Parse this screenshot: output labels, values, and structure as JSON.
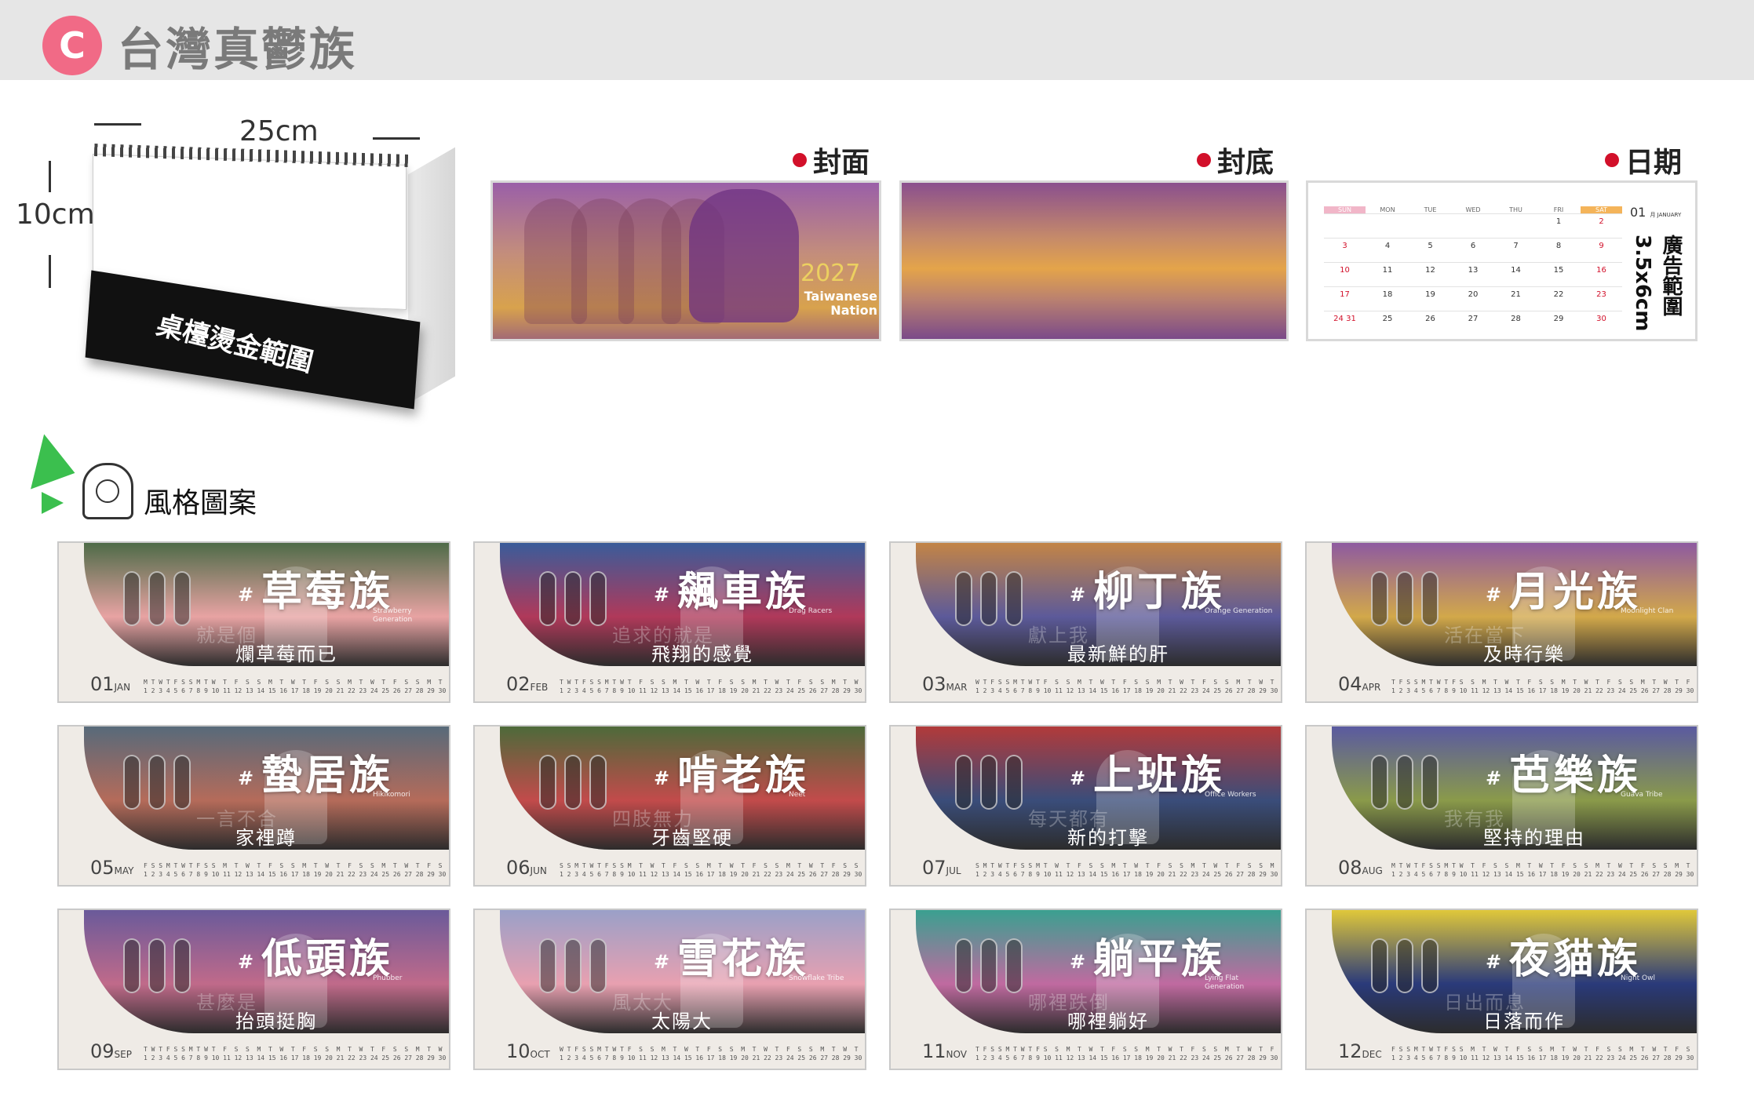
{
  "header": {
    "badge": "C",
    "title": "台灣真鬱族"
  },
  "desk": {
    "width_label": "25cm",
    "height_label": "10cm",
    "base_label": "桌檯燙金範圍"
  },
  "sections": {
    "cover": "封面",
    "back": "封底",
    "date": "日期",
    "style": "風格圖案"
  },
  "cover_art": {
    "year": "2027",
    "line1": "Taiwanese",
    "line2": "Nation"
  },
  "date_panel": {
    "weekdays": [
      "SUN",
      "MON",
      "TUE",
      "WED",
      "THU",
      "FRI",
      "SAT"
    ],
    "month_label": "01",
    "month_sub": "月 JANUARY",
    "ad_area": "廣告範圍",
    "ad_size": "3.5x6cm",
    "rows": [
      [
        "",
        "",
        "",
        "",
        "",
        "1",
        "2"
      ],
      [
        "3",
        "4",
        "5",
        "6",
        "7",
        "8",
        "9"
      ],
      [
        "10",
        "11",
        "12",
        "13",
        "14",
        "15",
        "16"
      ],
      [
        "17",
        "18",
        "19",
        "20",
        "21",
        "22",
        "23"
      ],
      [
        "24 31",
        "25",
        "26",
        "27",
        "28",
        "29",
        "30"
      ]
    ]
  },
  "months": [
    {
      "num": "01",
      "abbr": "JAN",
      "name": "草莓族",
      "en": "Strawberry Generation",
      "p1": "就是個",
      "p2": "爛草莓而已"
    },
    {
      "num": "02",
      "abbr": "FEB",
      "name": "飆車族",
      "en": "Drag Racers",
      "p1": "追求的就是",
      "p2": "飛翔的感覺"
    },
    {
      "num": "03",
      "abbr": "MAR",
      "name": "柳丁族",
      "en": "Orange Generation",
      "p1": "獻上我",
      "p2": "最新鮮的肝"
    },
    {
      "num": "04",
      "abbr": "APR",
      "name": "月光族",
      "en": "Moonlight Clan",
      "p1": "活在當下",
      "p2": "及時行樂"
    },
    {
      "num": "05",
      "abbr": "MAY",
      "name": "蟄居族",
      "en": "Hikikomori",
      "p1": "一言不合",
      "p2": "家裡蹲"
    },
    {
      "num": "06",
      "abbr": "JUN",
      "name": "啃老族",
      "en": "Neet",
      "p1": "四肢無力",
      "p2": "牙齒堅硬"
    },
    {
      "num": "07",
      "abbr": "JUL",
      "name": "上班族",
      "en": "Office Workers",
      "p1": "每天都有",
      "p2": "新的打擊"
    },
    {
      "num": "08",
      "abbr": "AUG",
      "name": "芭樂族",
      "en": "Guava Tribe",
      "p1": "我有我",
      "p2": "堅持的理由"
    },
    {
      "num": "09",
      "abbr": "SEP",
      "name": "低頭族",
      "en": "Phubber",
      "p1": "甚麼是",
      "p2": "抬頭挺胸"
    },
    {
      "num": "10",
      "abbr": "OCT",
      "name": "雪花族",
      "en": "Snowflake Tribe",
      "p1": "風太大",
      "p2": "太陽大"
    },
    {
      "num": "11",
      "abbr": "NOV",
      "name": "躺平族",
      "en": "Lying Flat Generation",
      "p1": "哪裡跌倒",
      "p2": "哪裡躺好"
    },
    {
      "num": "12",
      "abbr": "DEC",
      "name": "夜貓族",
      "en": "Night Owl",
      "p1": "日出而息",
      "p2": "日落而作"
    }
  ],
  "colors": {
    "accent_pink": "#f16a86",
    "dot_red": "#d2102a",
    "month_gradients": [
      [
        "#4e6b48",
        "#e8a3a3"
      ],
      [
        "#3a5c9a",
        "#b0395a"
      ],
      [
        "#c38446",
        "#5c5a9a"
      ],
      [
        "#8e5aa0",
        "#d2a84a"
      ],
      [
        "#576a7a",
        "#b56b5a"
      ],
      [
        "#4d6a3a",
        "#c24b4b"
      ],
      [
        "#b23a3a",
        "#3a4d7a"
      ],
      [
        "#5a5aa0",
        "#8a9a4a"
      ],
      [
        "#6a5a9a",
        "#c06a8a"
      ],
      [
        "#9aa0c8",
        "#e8a0b0"
      ],
      [
        "#3aa090",
        "#c06aa0"
      ],
      [
        "#e0c83a",
        "#2a3a7a"
      ]
    ]
  }
}
